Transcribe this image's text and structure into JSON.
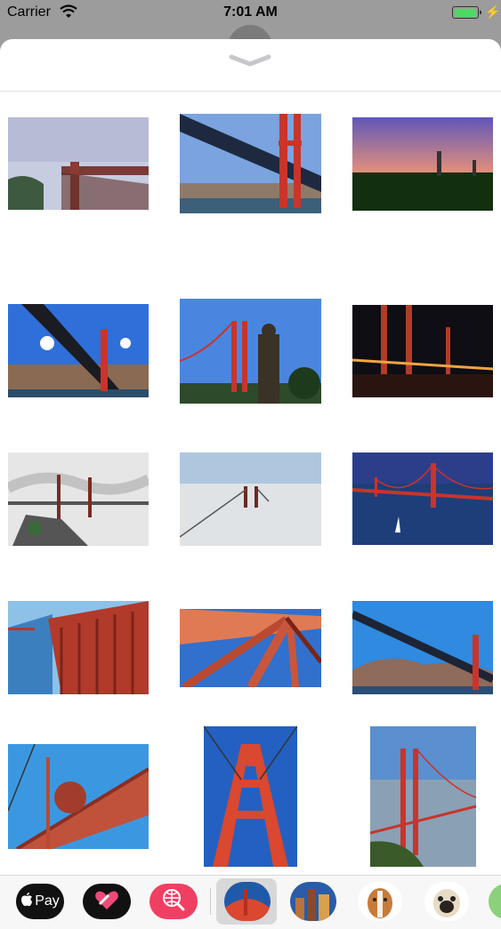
{
  "status_bar": {
    "carrier": "Carrier",
    "time": "7:01 AM",
    "battery_level": 1.0
  },
  "colors": {
    "accent_bridge": "#c8372a",
    "sky": "#3a7bd5",
    "battery": "#4cd964"
  },
  "sheet": {
    "collapse_icon": "chevron-down-icon"
  },
  "gallery": {
    "items": [
      {
        "subject": "bridge-fog"
      },
      {
        "subject": "bridge-underside"
      },
      {
        "subject": "bridge-sunset"
      },
      {
        "subject": "bridge-from-below"
      },
      {
        "subject": "bridge-statue"
      },
      {
        "subject": "bridge-night"
      },
      {
        "subject": "bridge-sketch"
      },
      {
        "subject": "bridge-tower-fog"
      },
      {
        "subject": "bridge-bay"
      },
      {
        "subject": "bridge-walkway"
      },
      {
        "subject": "bridge-cables"
      },
      {
        "subject": "bridge-hills"
      },
      {
        "subject": "bridge-cable-closeup"
      },
      {
        "subject": "bridge-tower-up"
      },
      {
        "subject": "bridge-tower-portrait"
      }
    ]
  },
  "app_drawer": {
    "apple_pay_label": "Pay",
    "apps": [
      "apple-pay",
      "heart-sticker",
      "web-search",
      "golden-gate-stickers",
      "city-stickers",
      "boxer-dog",
      "pug-dog",
      "more"
    ]
  }
}
